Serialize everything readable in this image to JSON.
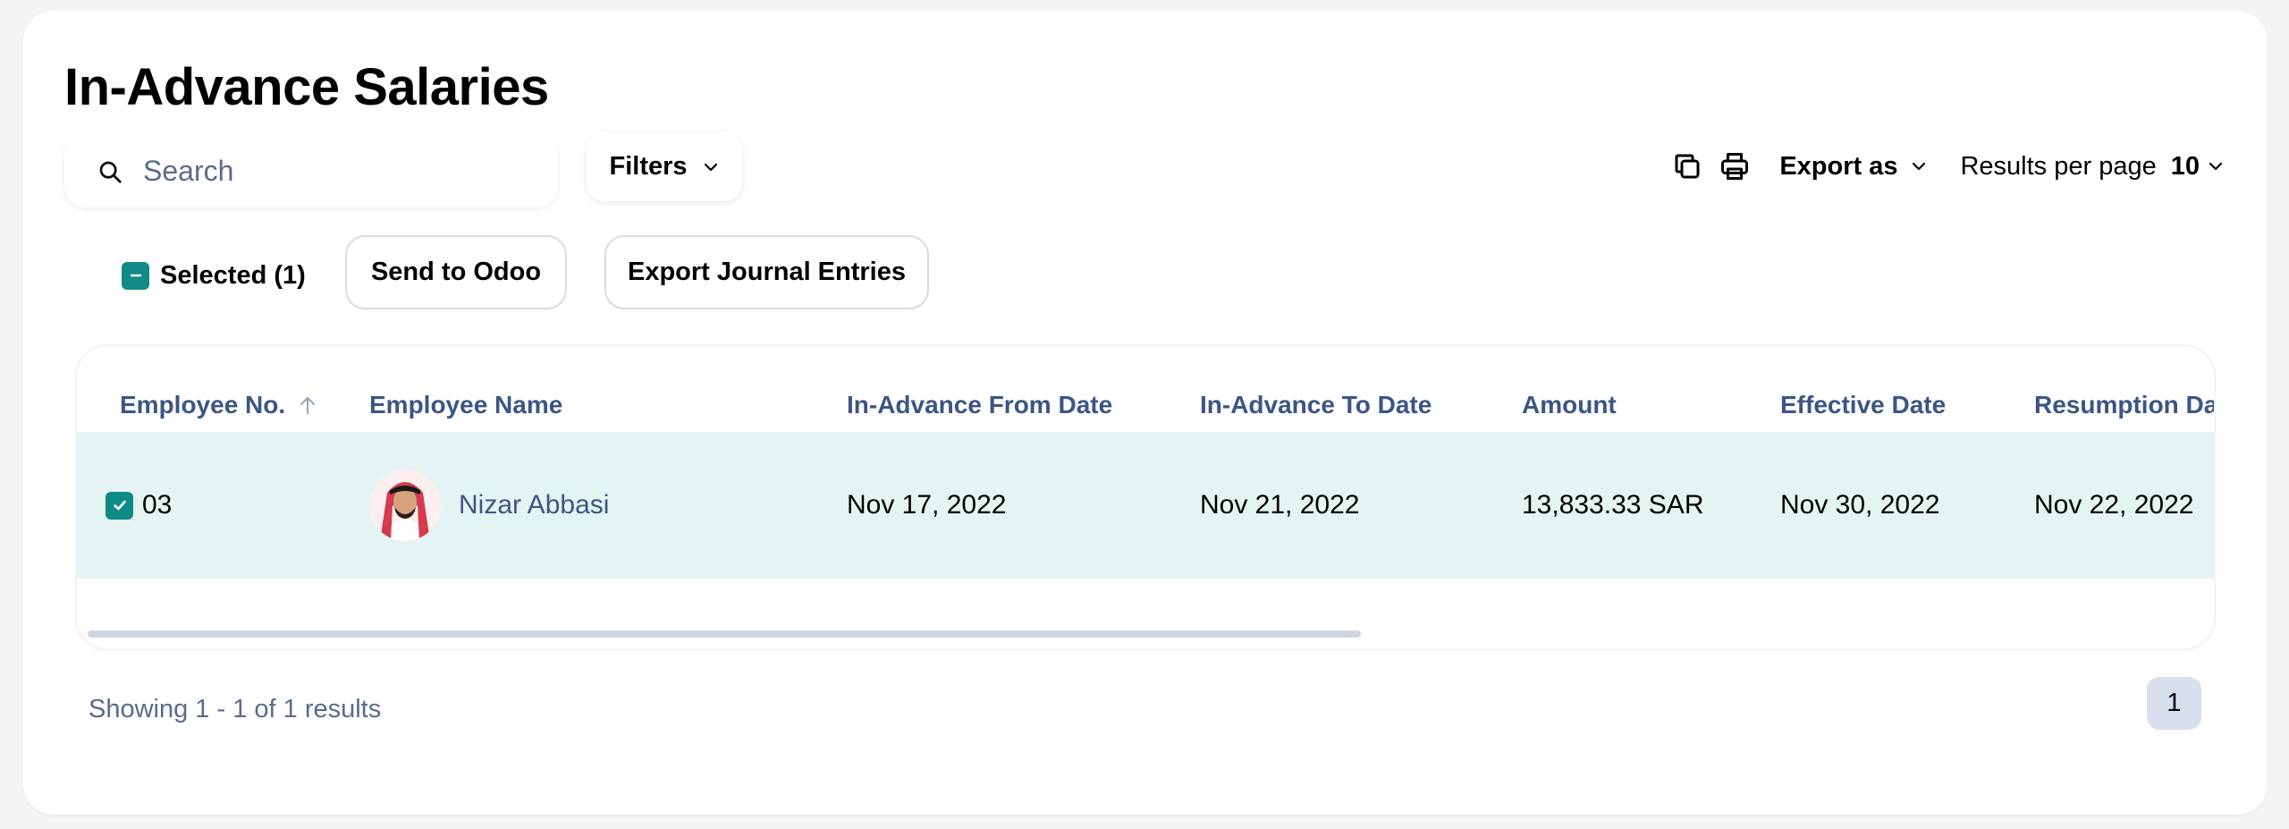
{
  "page": {
    "title": "In-Advance Salaries"
  },
  "search": {
    "placeholder": "Search"
  },
  "toolbar": {
    "filters_label": "Filters",
    "export_label": "Export as",
    "results_per_page_label": "Results per page",
    "results_per_page_value": "10",
    "copy_icon": "copy-icon",
    "print_icon": "printer-icon"
  },
  "selection": {
    "label": "Selected (1)",
    "send_to_odoo": "Send to Odoo",
    "export_journal_entries": "Export Journal Entries"
  },
  "table": {
    "columns": [
      "Employee No.",
      "Employee Name",
      "In-Advance From Date",
      "In-Advance To Date",
      "Amount",
      "Effective Date",
      "Resumption Da"
    ],
    "sort_icon": "arrow-up-icon",
    "rows": [
      {
        "selected": true,
        "employee_no": "03",
        "employee_name": "Nizar Abbasi",
        "from_date": "Nov 17, 2022",
        "to_date": "Nov 21, 2022",
        "amount": "13,833.33 SAR",
        "effective_date": "Nov 30, 2022",
        "resumption_date": "Nov 22, 2022"
      }
    ]
  },
  "pagination": {
    "summary": "Showing 1 - 1 of 1 results",
    "current_page": "1"
  },
  "colors": {
    "accent": "#108a86",
    "row_highlight": "#e3f4f3",
    "header_text": "#3c5584",
    "muted_text": "#5b6b8c"
  }
}
